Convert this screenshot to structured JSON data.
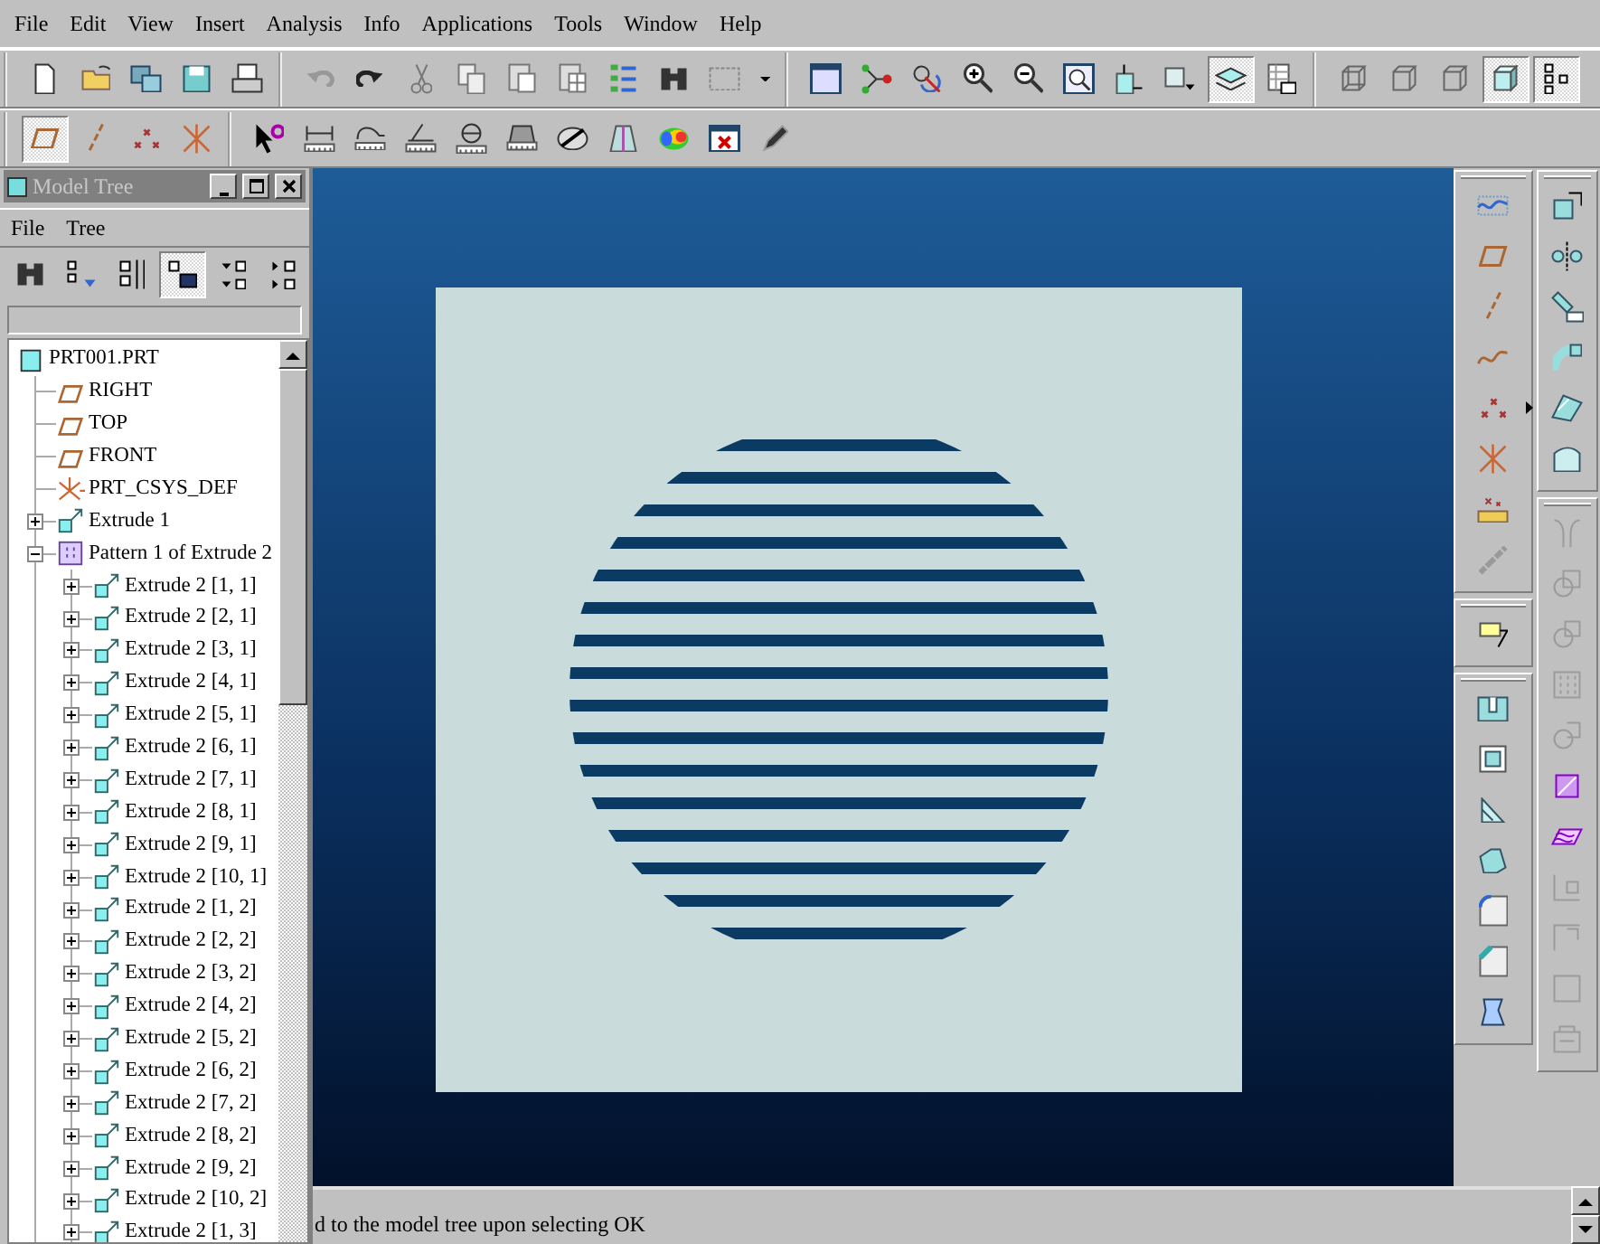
{
  "menu": [
    "File",
    "Edit",
    "View",
    "Insert",
    "Analysis",
    "Info",
    "Applications",
    "Tools",
    "Window",
    "Help"
  ],
  "toolbar_rows": [
    {
      "groups": [
        [
          {
            "kind": "new",
            "pressed": false
          },
          {
            "kind": "open",
            "pressed": false
          },
          {
            "kind": "save-copy",
            "pressed": false
          },
          {
            "kind": "save",
            "pressed": false
          },
          {
            "kind": "print",
            "pressed": false
          }
        ],
        [
          {
            "kind": "undo",
            "pressed": false
          },
          {
            "kind": "redo",
            "pressed": false
          },
          {
            "kind": "cut",
            "pressed": false
          },
          {
            "kind": "copy",
            "pressed": false
          },
          {
            "kind": "paste",
            "pressed": false
          },
          {
            "kind": "paste-special",
            "pressed": false
          },
          {
            "kind": "regenerate",
            "pressed": false
          },
          {
            "kind": "find",
            "pressed": false
          },
          {
            "kind": "select-box",
            "pressed": false
          },
          {
            "kind": "dropdown",
            "pressed": false
          }
        ],
        [
          {
            "kind": "repaint",
            "pressed": false
          },
          {
            "kind": "spin-center",
            "pressed": false
          },
          {
            "kind": "orient",
            "pressed": false
          },
          {
            "kind": "zoom-in",
            "pressed": false
          },
          {
            "kind": "zoom-out",
            "pressed": false
          },
          {
            "kind": "refit",
            "pressed": false
          },
          {
            "kind": "saved-view",
            "pressed": false
          },
          {
            "kind": "named-view",
            "pressed": false
          },
          {
            "kind": "layers",
            "pressed": true
          },
          {
            "kind": "view-manager",
            "pressed": false
          }
        ],
        [
          {
            "kind": "wireframe",
            "pressed": false
          },
          {
            "kind": "hidden-line",
            "pressed": false
          },
          {
            "kind": "no-hidden",
            "pressed": false
          },
          {
            "kind": "shaded",
            "pressed": true
          },
          {
            "kind": "model-tree",
            "pressed": true
          }
        ]
      ]
    },
    {
      "groups": [
        [
          {
            "kind": "datum-plane",
            "pressed": true
          },
          {
            "kind": "datum-axis",
            "pressed": false
          },
          {
            "kind": "datum-point",
            "pressed": false
          },
          {
            "kind": "csys",
            "pressed": false
          }
        ],
        [
          {
            "kind": "help",
            "pressed": false
          },
          {
            "kind": "measure-distance",
            "pressed": false
          },
          {
            "kind": "measure-length",
            "pressed": false
          },
          {
            "kind": "measure-angle",
            "pressed": false
          },
          {
            "kind": "measure-diameter",
            "pressed": false
          },
          {
            "kind": "mass",
            "pressed": false
          },
          {
            "kind": "section",
            "pressed": false
          },
          {
            "kind": "draft-check",
            "pressed": false
          },
          {
            "kind": "curvature",
            "pressed": false
          },
          {
            "kind": "delete-analysis",
            "pressed": false
          },
          {
            "kind": "pencil",
            "pressed": false
          }
        ]
      ]
    }
  ],
  "model_tree": {
    "title": "Model Tree",
    "menu": [
      "File",
      "Tree"
    ],
    "tools": [
      {
        "kind": "find",
        "pressed": false
      },
      {
        "kind": "tree-filter",
        "pressed": false
      },
      {
        "kind": "columns",
        "pressed": false
      },
      {
        "kind": "tree-columns",
        "pressed": true
      },
      {
        "kind": "expand",
        "pressed": false
      },
      {
        "kind": "collapse",
        "pressed": false
      }
    ],
    "items": [
      {
        "label": "PRT001.PRT",
        "kind": "part",
        "children": [
          {
            "label": "RIGHT",
            "kind": "plane"
          },
          {
            "label": "TOP",
            "kind": "plane"
          },
          {
            "label": "FRONT",
            "kind": "plane"
          },
          {
            "label": "PRT_CSYS_DEF",
            "kind": "csys"
          },
          {
            "label": "Extrude 1",
            "kind": "extrude",
            "expanded": false
          },
          {
            "label": "Pattern 1 of Extrude 2",
            "kind": "pattern",
            "expanded": true,
            "children": [
              {
                "label": "Extrude 2 [1, 1]",
                "kind": "extrude",
                "expanded": false
              },
              {
                "label": "Extrude 2 [2, 1]",
                "kind": "extrude",
                "expanded": false
              },
              {
                "label": "Extrude 2 [3, 1]",
                "kind": "extrude",
                "expanded": false
              },
              {
                "label": "Extrude 2 [4, 1]",
                "kind": "extrude",
                "expanded": false
              },
              {
                "label": "Extrude 2 [5, 1]",
                "kind": "extrude",
                "expanded": false
              },
              {
                "label": "Extrude 2 [6, 1]",
                "kind": "extrude",
                "expanded": false
              },
              {
                "label": "Extrude 2 [7, 1]",
                "kind": "extrude",
                "expanded": false
              },
              {
                "label": "Extrude 2 [8, 1]",
                "kind": "extrude",
                "expanded": false
              },
              {
                "label": "Extrude 2 [9, 1]",
                "kind": "extrude",
                "expanded": false
              },
              {
                "label": "Extrude 2 [10, 1]",
                "kind": "extrude",
                "expanded": false
              },
              {
                "label": "Extrude 2 [1, 2]",
                "kind": "extrude",
                "expanded": false
              },
              {
                "label": "Extrude 2 [2, 2]",
                "kind": "extrude",
                "expanded": false
              },
              {
                "label": "Extrude 2 [3, 2]",
                "kind": "extrude",
                "expanded": false
              },
              {
                "label": "Extrude 2 [4, 2]",
                "kind": "extrude",
                "expanded": false
              },
              {
                "label": "Extrude 2 [5, 2]",
                "kind": "extrude",
                "expanded": false
              },
              {
                "label": "Extrude 2 [6, 2]",
                "kind": "extrude",
                "expanded": false
              },
              {
                "label": "Extrude 2 [7, 2]",
                "kind": "extrude",
                "expanded": false
              },
              {
                "label": "Extrude 2 [8, 2]",
                "kind": "extrude",
                "expanded": false
              },
              {
                "label": "Extrude 2 [9, 2]",
                "kind": "extrude",
                "expanded": false
              },
              {
                "label": "Extrude 2 [10, 2]",
                "kind": "extrude",
                "expanded": false
              },
              {
                "label": "Extrude 2 [1, 3]",
                "kind": "extrude",
                "expanded": false
              }
            ]
          }
        ]
      }
    ]
  },
  "side_toolbars": [
    {
      "groups": [
        [
          {
            "kind": "sketch",
            "disabled": false
          },
          {
            "kind": "datum-plane",
            "disabled": false
          },
          {
            "kind": "datum-axis",
            "disabled": false
          },
          {
            "kind": "datum-curve",
            "disabled": false
          },
          {
            "kind": "datum-point",
            "disabled": false,
            "flyout": true
          },
          {
            "kind": "csys",
            "disabled": false
          },
          {
            "kind": "analysis",
            "disabled": false
          },
          {
            "kind": "chain",
            "disabled": false
          }
        ],
        [
          {
            "kind": "note",
            "disabled": false
          }
        ],
        [
          {
            "kind": "hole",
            "disabled": false
          },
          {
            "kind": "shell",
            "disabled": false
          },
          {
            "kind": "rib",
            "disabled": false
          },
          {
            "kind": "draft",
            "disabled": false
          },
          {
            "kind": "round",
            "disabled": false
          },
          {
            "kind": "chamfer",
            "disabled": false
          },
          {
            "kind": "cosmetic",
            "disabled": false
          }
        ]
      ]
    },
    {
      "groups": [
        [
          {
            "kind": "copy-geometry",
            "disabled": false
          },
          {
            "kind": "mirror",
            "disabled": false
          },
          {
            "kind": "move",
            "disabled": false
          },
          {
            "kind": "sweep",
            "disabled": false
          },
          {
            "kind": "blend",
            "disabled": false
          },
          {
            "kind": "fill",
            "disabled": false
          }
        ],
        [
          {
            "kind": "split",
            "disabled": true
          },
          {
            "kind": "intersect",
            "disabled": true
          },
          {
            "kind": "merge",
            "disabled": true
          },
          {
            "kind": "pattern",
            "disabled": true
          },
          {
            "kind": "trim",
            "disabled": true
          },
          {
            "kind": "offset",
            "disabled": false
          },
          {
            "kind": "thicken",
            "disabled": false
          },
          {
            "kind": "extend",
            "disabled": true
          },
          {
            "kind": "solidify",
            "disabled": true
          },
          {
            "kind": "frame",
            "disabled": true
          },
          {
            "kind": "box",
            "disabled": true
          }
        ]
      ]
    }
  ],
  "message": "d to the model tree upon selecting OK"
}
